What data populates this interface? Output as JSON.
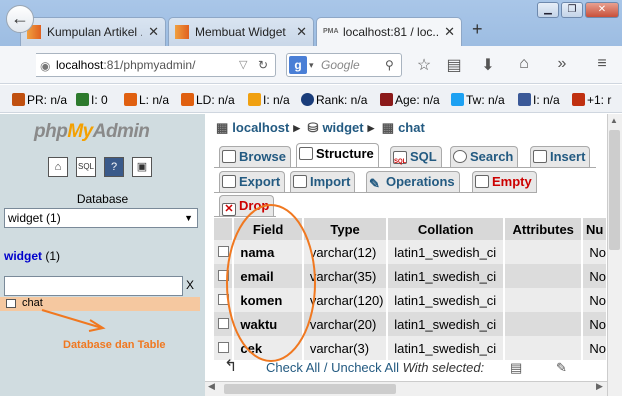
{
  "browser": {
    "tabs": [
      {
        "label": "Kumpulan Artikel ...",
        "close": "✕"
      },
      {
        "label": "Membuat Widget ...",
        "close": "✕"
      },
      {
        "label": "localhost:81 / loc...",
        "close": "✕",
        "favicon": "PMA"
      }
    ],
    "new_tab": "+",
    "url_host": "localhost",
    "url_rest": ":81/phpmyadmin/",
    "search_engine_icon": "g-icon",
    "search_placeholder": "Google"
  },
  "addons": [
    {
      "label": "PR: n/a",
      "color": "#c05010"
    },
    {
      "label": "I: 0",
      "color": "#2d7a2d"
    },
    {
      "label": "L: n/a",
      "color": "#e06010"
    },
    {
      "label": "LD: n/a",
      "color": "#e06010"
    },
    {
      "label": "I: n/a",
      "color": "#f0a010"
    },
    {
      "label": "Rank: n/a",
      "color": "#1a3d7a"
    },
    {
      "label": "Age: n/a",
      "color": "#8b1a1a"
    },
    {
      "label": "Tw: n/a",
      "color": "#1da1f2"
    },
    {
      "label": "I: n/a",
      "color": "#3b5998"
    },
    {
      "label": "+1: r",
      "color": "#c03010"
    }
  ],
  "sidebar": {
    "logo_php": "php",
    "logo_my": "My",
    "logo_admin": "Admin",
    "database_label": "Database",
    "database_selected": "widget (1)",
    "db_link_name": "widget",
    "db_link_count": "(1)",
    "filter_clear": "X",
    "table_name": "chat",
    "annotation": "Database dan Table"
  },
  "breadcrumb": {
    "server": "localhost",
    "database": "widget",
    "table": "chat"
  },
  "tabs_row1": [
    {
      "label": "Browse",
      "icon": "browse-icon"
    },
    {
      "label": "Structure",
      "icon": "structure-icon"
    },
    {
      "label": "SQL",
      "icon": "sql-icon"
    },
    {
      "label": "Search",
      "icon": "search-icon"
    },
    {
      "label": "Insert",
      "icon": "insert-icon"
    }
  ],
  "tabs_row2": [
    {
      "label": "Export",
      "icon": "export-icon"
    },
    {
      "label": "Import",
      "icon": "import-icon"
    },
    {
      "label": "Operations",
      "icon": "operations-icon"
    },
    {
      "label": "Empty",
      "icon": "empty-icon"
    }
  ],
  "tabs_row3": [
    {
      "label": "Drop",
      "icon": "drop-icon"
    }
  ],
  "table": {
    "headers": [
      "Field",
      "Type",
      "Collation",
      "Attributes",
      "Nu"
    ],
    "rows": [
      {
        "field": "nama",
        "type": "varchar(12)",
        "collation": "latin1_swedish_ci",
        "attributes": "",
        "null": "No"
      },
      {
        "field": "email",
        "type": "varchar(35)",
        "collation": "latin1_swedish_ci",
        "attributes": "",
        "null": "No"
      },
      {
        "field": "komen",
        "type": "varchar(120)",
        "collation": "latin1_swedish_ci",
        "attributes": "",
        "null": "No"
      },
      {
        "field": "waktu",
        "type": "varchar(20)",
        "collation": "latin1_swedish_ci",
        "attributes": "",
        "null": "No"
      },
      {
        "field": "cek",
        "type": "varchar(3)",
        "collation": "latin1_swedish_ci",
        "attributes": "",
        "null": "No"
      }
    ]
  },
  "footer": {
    "check_all": "Check All",
    "separator": "/",
    "uncheck_all": "Uncheck All",
    "with_selected": "With selected:"
  },
  "colors": {
    "accent": "#235a81",
    "annotation": "#f07820",
    "drop": "#cc0000"
  }
}
